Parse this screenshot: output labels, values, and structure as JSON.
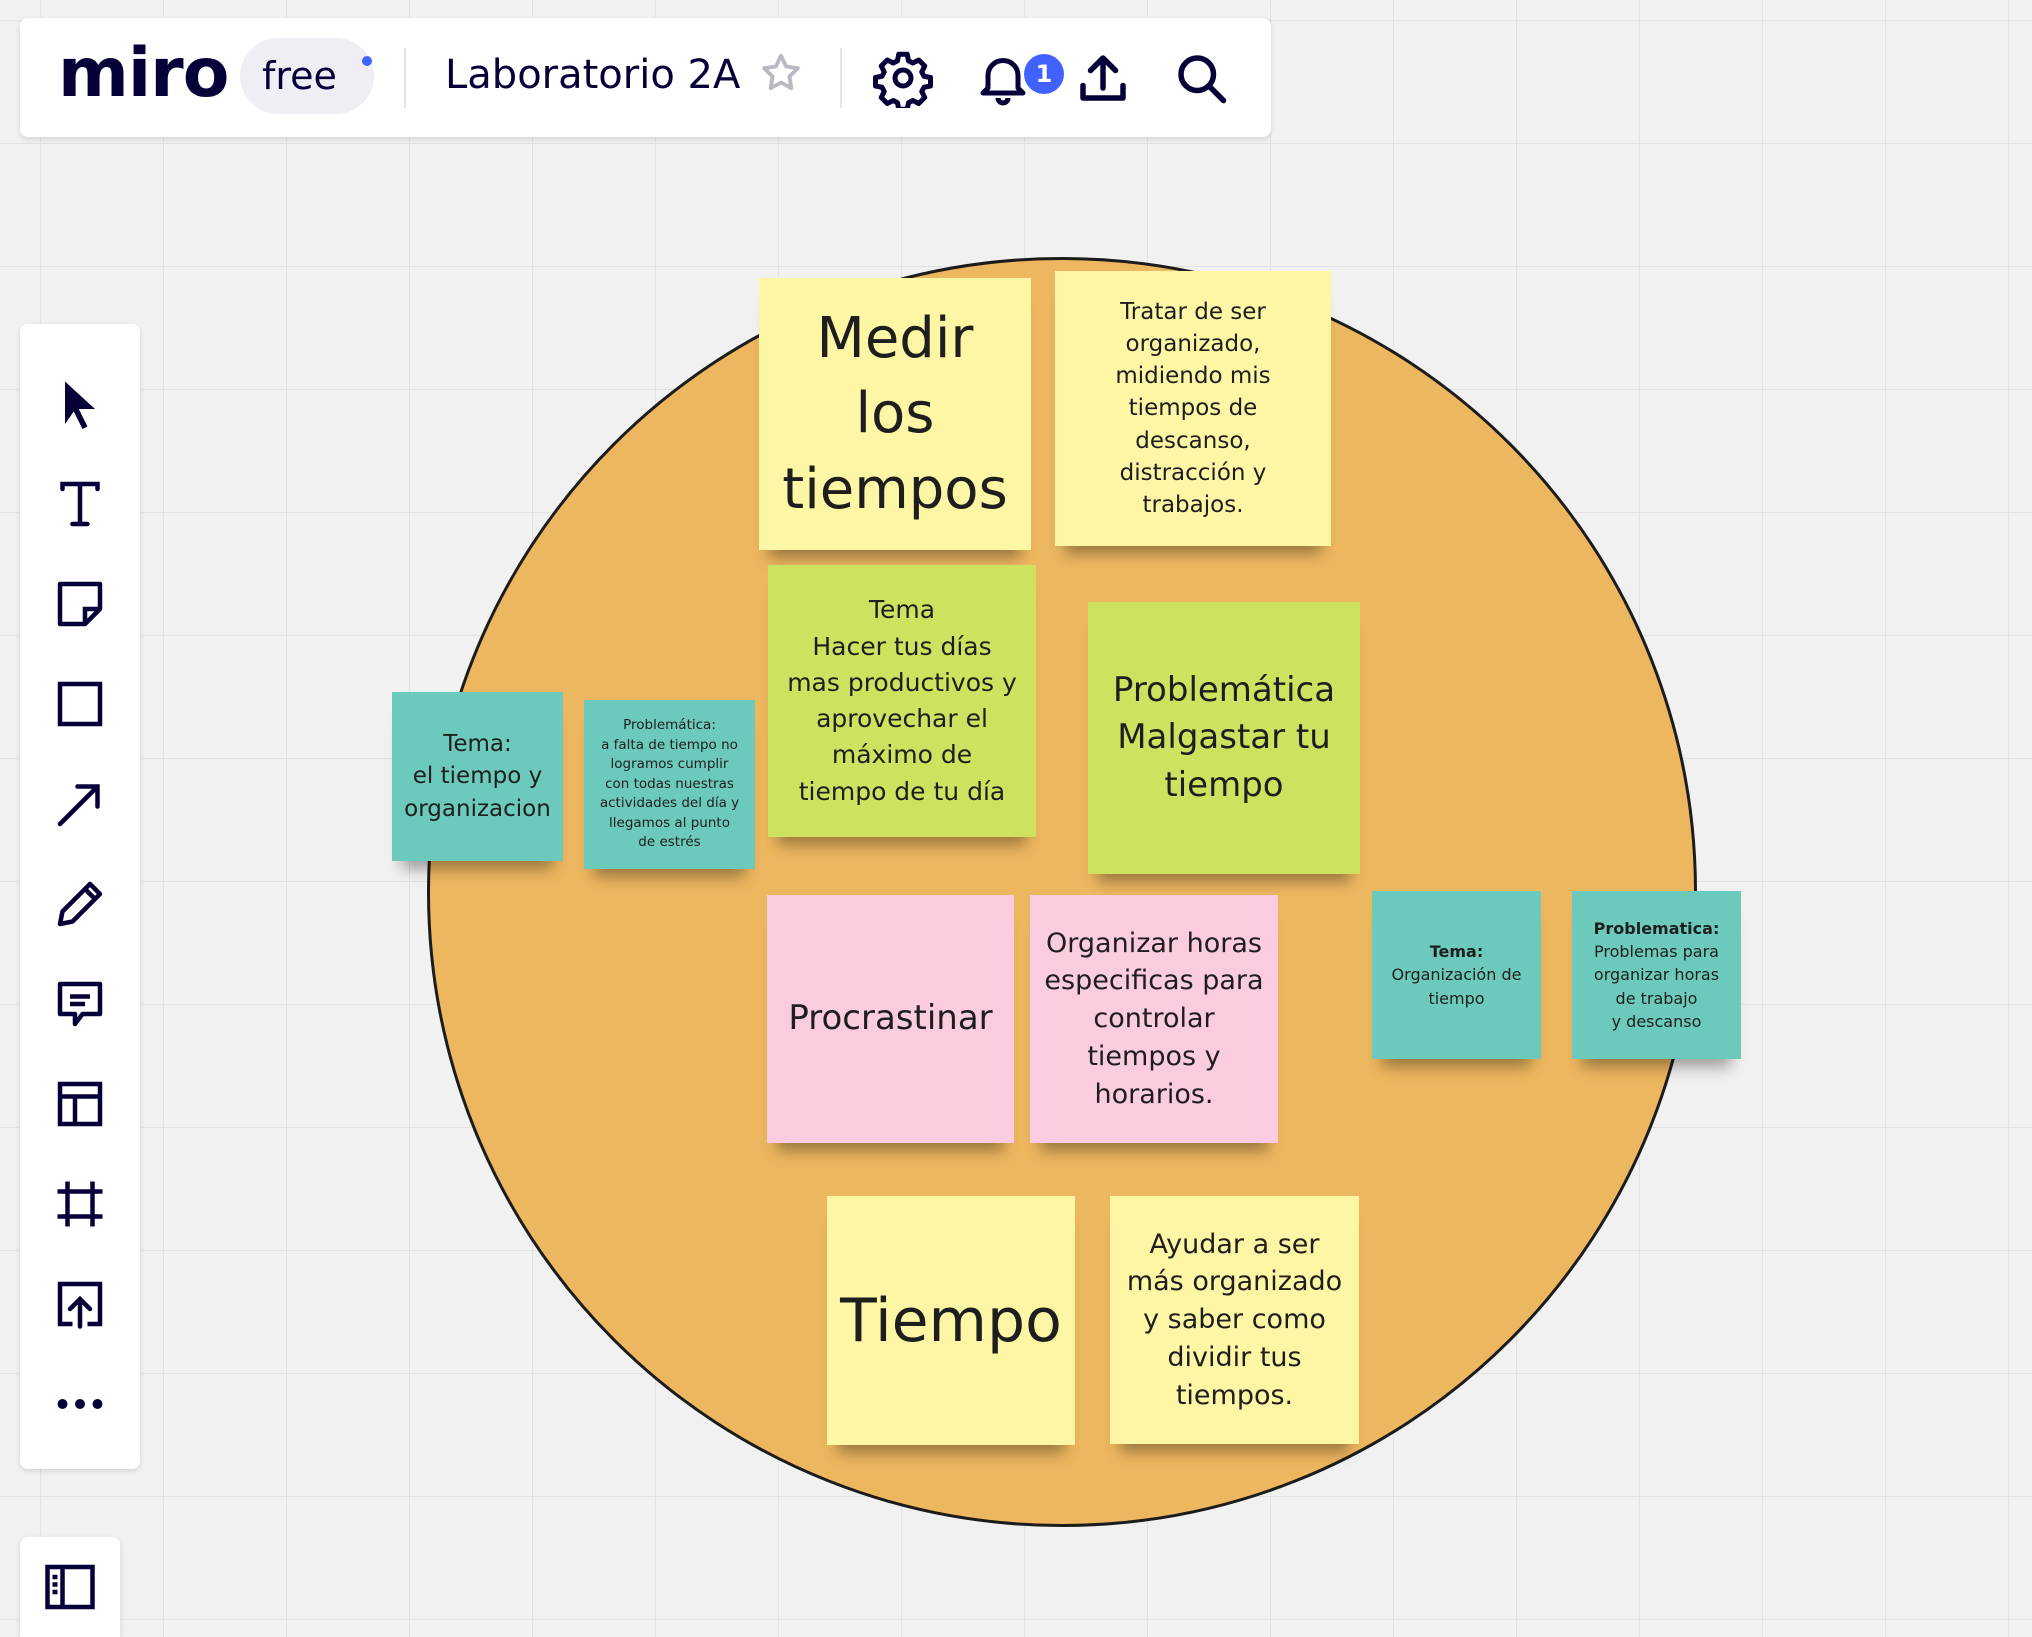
{
  "topbar": {
    "logo": "miro",
    "plan": "free",
    "board_title": "Laboratorio 2A",
    "notifications_count": "1"
  },
  "icons": {
    "star": "star-icon",
    "settings": "gear-icon",
    "notifications": "bell-icon",
    "share": "upload-icon",
    "search": "search-icon"
  },
  "colors": {
    "circle": "#edb75f",
    "yellow_note": "#fdf6a4",
    "green_note": "#cde35f",
    "pink_note": "#fbcce0",
    "teal_note": "#6ccabc",
    "accent": "#4262ff"
  },
  "toolbar": {
    "tools": [
      "select",
      "text",
      "sticky-note",
      "shape",
      "arrow",
      "pen",
      "comment",
      "template",
      "frame",
      "upload",
      "more"
    ]
  },
  "board": {
    "notes": {
      "medir": "Medir\nlos\ntiempos",
      "tratar": "Tratar de ser\norganizado,\nmidiendo mis\ntiempos de\ndescanso,\ndistracción y\ntrabajos.",
      "tema_hacer": "Tema\nHacer tus días\nmas productivos y\naprovechar el\nmáximo de\ntiempo de tu día",
      "problematica_malgastar": "Problemática\nMalgastar tu\ntiempo",
      "tema_tiempo_org": "Tema:\nel tiempo y\norganizacion",
      "problematica_falta": "Problemática:\na falta de tiempo no\nlogramos cumplir\ncon todas nuestras\nactividades del día y\nllegamos al punto\nde estrés",
      "procrastinar": "Procrastinar",
      "organizar_horas": "Organizar horas\nespecificas para\ncontrolar\ntiempos y\nhorarios.",
      "tema_org_title": "Tema:",
      "tema_org_body": "Organización de\ntiempo",
      "problematica_horas_title": "Problematica:",
      "problematica_horas_body": "Problemas para\norganizar horas\nde trabajo\ny descanso",
      "tiempo": "Tiempo",
      "ayudar": "Ayudar a ser\nmás organizado\ny saber como\ndividir tus\ntiempos."
    }
  }
}
